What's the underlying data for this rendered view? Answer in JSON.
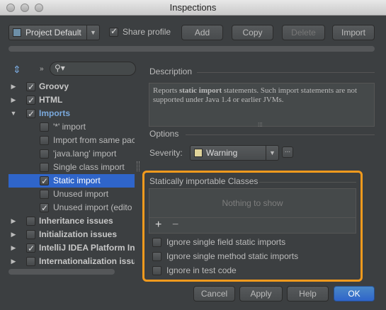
{
  "window": {
    "title": "Inspections"
  },
  "profile": {
    "selected": "Project Default",
    "share_label": "Share profile",
    "share_checked": true
  },
  "toolbar": {
    "add": "Add",
    "copy": "Copy",
    "delete": "Delete",
    "import": "Import"
  },
  "search": {
    "placeholder": ""
  },
  "tree": {
    "items": [
      {
        "label": "Groovy",
        "checked": true,
        "expanded": false
      },
      {
        "label": "HTML",
        "checked": true,
        "expanded": false
      },
      {
        "label": "Imports",
        "checked": true,
        "expanded": true
      },
      {
        "label": "'*' import",
        "checked": false
      },
      {
        "label": "Import from same pac",
        "checked": false
      },
      {
        "label": "'java.lang' import",
        "checked": false
      },
      {
        "label": "Single class import",
        "checked": false
      },
      {
        "label": "Static import",
        "checked": true,
        "selected": true
      },
      {
        "label": "Unused import",
        "checked": false
      },
      {
        "label": "Unused import (edito",
        "checked": true
      },
      {
        "label": "Inheritance issues",
        "checked": false,
        "expanded": false
      },
      {
        "label": "Initialization issues",
        "checked": false,
        "expanded": false
      },
      {
        "label": "IntelliJ IDEA Platform In",
        "checked": true,
        "expanded": false
      },
      {
        "label": "Internationalization issu",
        "checked": false,
        "expanded": false
      }
    ]
  },
  "description": {
    "heading": "Description",
    "prefix": "Reports ",
    "keyword": "static import",
    "suffix": " statements. Such import statements are not supported under Java 1.4 or earlier JVMs."
  },
  "options": {
    "heading": "Options",
    "severity_label": "Severity:",
    "severity_value": "Warning",
    "severity_color": "#e0d49a",
    "more_button": "..."
  },
  "classes": {
    "heading": "Statically importable Classes",
    "empty_text": "Nothing to show",
    "add_icon": "+",
    "remove_icon": "−"
  },
  "checkboxes": [
    {
      "label": "Ignore single field static imports",
      "checked": false
    },
    {
      "label": "Ignore single method static imports",
      "checked": false
    },
    {
      "label": "Ignore in test code",
      "checked": false
    }
  ],
  "footer": {
    "cancel": "Cancel",
    "apply": "Apply",
    "help": "Help",
    "ok": "OK"
  },
  "colors": {
    "highlight": "#f29a1d",
    "selection": "#2f65ca"
  }
}
